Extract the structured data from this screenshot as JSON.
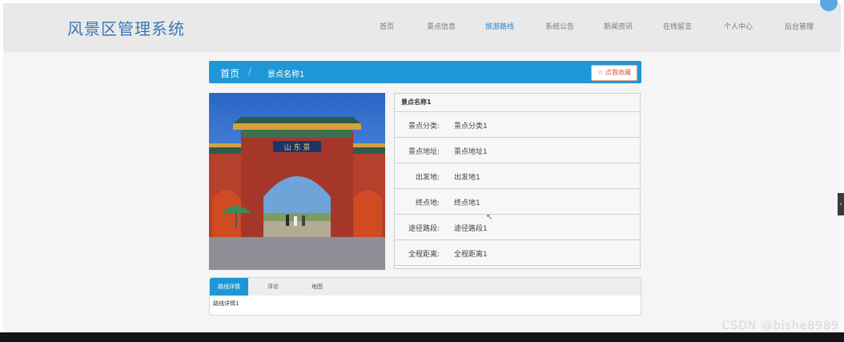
{
  "header": {
    "title": "风景区管理系统",
    "nav": [
      "首页",
      "景点信息",
      "旅游路线",
      "系统公告",
      "新闻资讯",
      "在线留言",
      "个人中心",
      "后台管理"
    ],
    "active_nav": "旅游路线"
  },
  "breadcrumb": {
    "home": "首页",
    "separator": "/",
    "current": "景点名称1"
  },
  "favorite_button": "☆ 点我收藏",
  "detail": {
    "title": "景点名称1",
    "rows": [
      {
        "key": "景点分类:",
        "value": "景点分类1"
      },
      {
        "key": "景点地址:",
        "value": "景点地址1"
      },
      {
        "key": "出发地:",
        "value": "出发地1"
      },
      {
        "key": "终点地:",
        "value": "终点地1"
      },
      {
        "key": "途径路段:",
        "value": "途径路段1"
      },
      {
        "key": "全程距离:",
        "value": "全程距离1"
      }
    ]
  },
  "tabs": {
    "labels": [
      "路线详情",
      "评论",
      "地图"
    ],
    "content": "路线详情1"
  },
  "side_tab": "‹",
  "watermark": "CSDN @bishe8989",
  "colors": {
    "accent": "#1f97d6",
    "brand": "#3a78b4",
    "favorite": "#d15a2f"
  }
}
